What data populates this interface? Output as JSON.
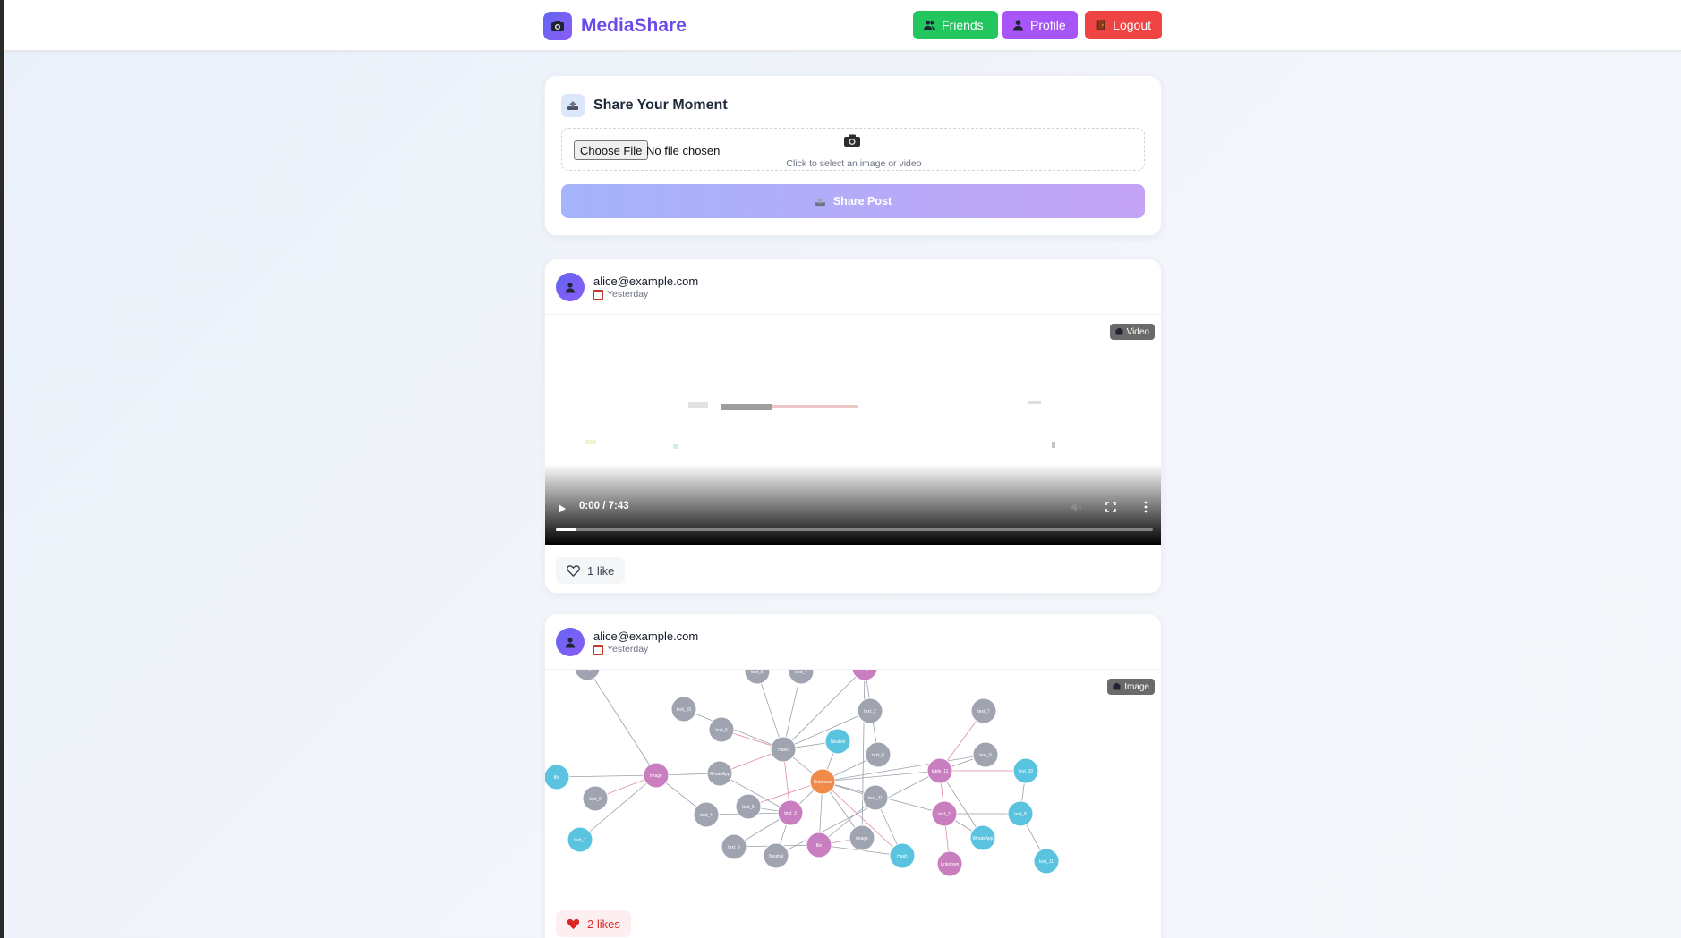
{
  "app": {
    "name": "MediaShare",
    "nav": {
      "friends": "Friends",
      "profile": "Profile",
      "logout": "Logout"
    }
  },
  "upload": {
    "title": "Share Your Moment",
    "file_button": "Choose File",
    "file_status": "No file chosen",
    "hint": "Click to select an image or video",
    "share_button": "Share Post"
  },
  "posts": [
    {
      "user": "alice@example.com",
      "time": "Yesterday",
      "media_type": "Video",
      "video_time": "0:00 / 7:43",
      "likes": "1 like",
      "liked": false
    },
    {
      "user": "alice@example.com",
      "time": "Yesterday",
      "media_type": "Image",
      "likes": "2 likes",
      "liked": true,
      "graph_labels": [
        "table_11",
        "text_10",
        "text_6",
        "text_5",
        "text_4",
        "text_3",
        "text_2",
        "text_8",
        "text_7",
        "text_9",
        "file",
        "image",
        "WhatsApp",
        "Hash",
        "Neutral",
        "Unknown",
        "text_11"
      ]
    }
  ],
  "colors": {
    "brand": "#6a4be8",
    "friends": "#22c55e",
    "profile": "#a855f7",
    "logout": "#ef4444",
    "like_red": "#dc2626"
  }
}
